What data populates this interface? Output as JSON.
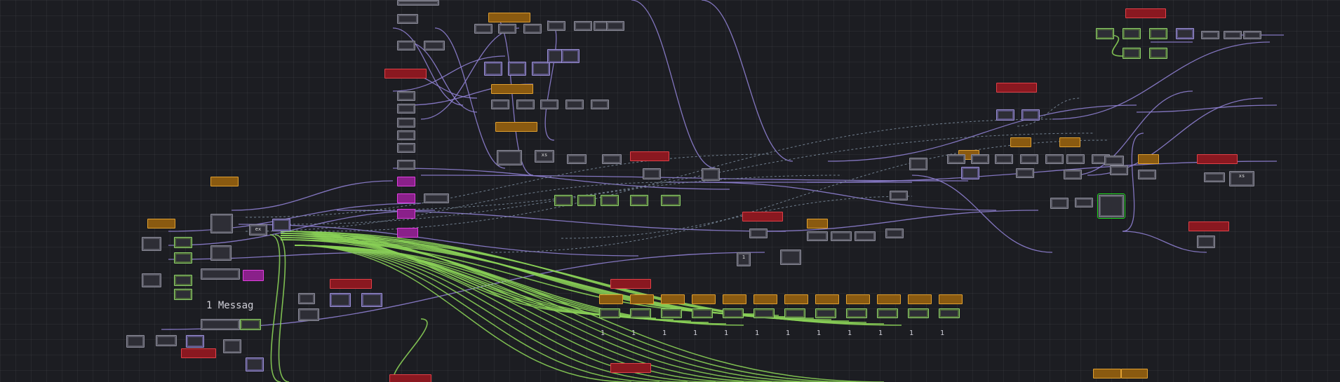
{
  "app": {
    "type": "node-network-editor"
  },
  "colors": {
    "background": "#1c1d22",
    "wire_purple": "#8e7fd0",
    "wire_green": "#8ad056",
    "wire_dotted": "#7a8a9a",
    "node_orange": "#e0a030",
    "node_red": "#e04048",
    "node_magenta": "#e040e0",
    "selection": "#22e022"
  },
  "node_labels": {
    "message": "Messag",
    "count_one": "1",
    "mini_text": "1",
    "op_nested_text": "ex",
    "op_xtext": "xs"
  },
  "node_types": {
    "top": "base",
    "comp": "comp",
    "chop": "chop",
    "dat": "dat",
    "null": "null",
    "select": "select",
    "math": "math",
    "switch": "switch",
    "text": "text",
    "script": "script"
  }
}
